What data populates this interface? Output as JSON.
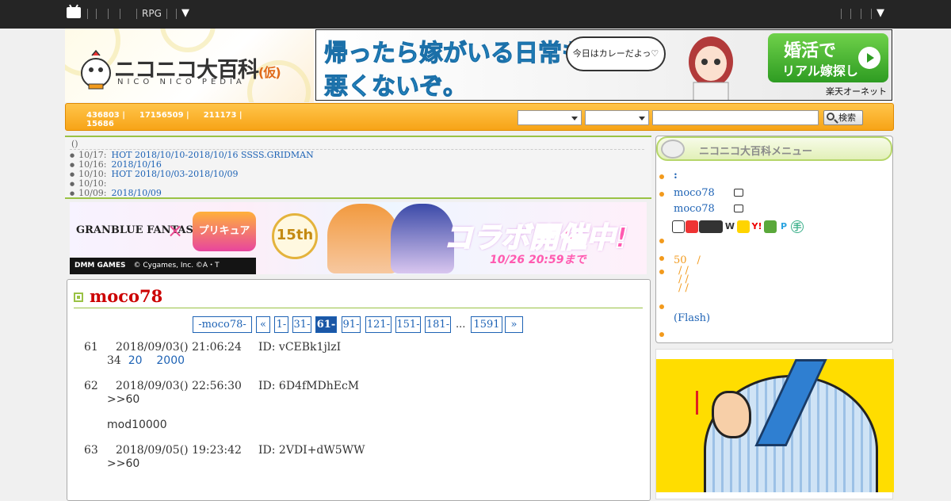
{
  "topbar": {
    "rpg_label": "RPG",
    "dropdown_caret": "▼",
    "right_caret": "▼"
  },
  "header": {
    "logo_text": "ニコニコ大百科",
    "logo_kari": "(仮)",
    "logo_sub": "NICO NICO PEDIA",
    "banner": {
      "line1": "帰ったら嫁がいる日常も",
      "line2": "悪くないぞ。",
      "bubble": "今日はカレーだよっ♡",
      "cta_line1": "婚活で",
      "cta_line2": "リアル嫁探し",
      "sponsor": "楽天オーネット"
    }
  },
  "stats": {
    "s1": "436803 |",
    "s2": "17156509 |",
    "s3": "211173 |",
    "s4": "15686"
  },
  "search": {
    "button_label": "検索",
    "placeholder": ""
  },
  "news": {
    "heading": "()",
    "items": [
      {
        "date": "10/17:",
        "text": "HOT 2018/10/10-2018/10/16 SSSS.GRIDMAN"
      },
      {
        "date": "10/16:",
        "text": "2018/10/16"
      },
      {
        "date": "10/10:",
        "text": "HOT 2018/10/03-2018/10/09"
      },
      {
        "date": "10/10:",
        "text": ""
      },
      {
        "date": "10/09:",
        "text": "2018/10/09"
      }
    ]
  },
  "collab_banner": {
    "gbf": "GRANBLUE FANTASY",
    "cross": "×",
    "precure": "プリキュア",
    "anniv": "15th",
    "catch": "コラボ開催中!",
    "until": "10/26 20:59まで",
    "footer_brand": "DMM GAMES",
    "footer_copy": "© Cygames, Inc.  ©A・T"
  },
  "article": {
    "title": "moco78",
    "pager": [
      {
        "label": "-moco78-"
      },
      {
        "label": "«"
      },
      {
        "label": "1-"
      },
      {
        "label": "31-"
      },
      {
        "label": "61-",
        "active": true
      },
      {
        "label": "91-"
      },
      {
        "label": "121-"
      },
      {
        "label": "151-"
      },
      {
        "label": "181-"
      },
      {
        "label": "..."
      },
      {
        "label": "1591"
      },
      {
        "label": "»"
      }
    ],
    "posts": [
      {
        "num": "61",
        "datetime": "2018/09/03() 21:06:24",
        "id": "ID: vCEBk1jlzI",
        "body_prefix": "34",
        "links": [
          "20",
          "2000"
        ]
      },
      {
        "num": "62",
        "datetime": "2018/09/03() 22:56:30",
        "id": "ID: 6D4fMDhEcM",
        "reply": ">>60",
        "extra": "mod10000"
      },
      {
        "num": "63",
        "datetime": "2018/09/05() 19:23:42",
        "id": "ID: 2VDI+dW5WW",
        "reply": ">>60"
      }
    ]
  },
  "sidebar": {
    "menu_title": "ニコニコ大百科メニュー",
    "items": [
      {
        "text": ":"
      },
      {
        "text": "moco78"
      },
      {
        "text": "moco78"
      },
      {
        "text": ""
      },
      {
        "text": "50　/"
      },
      {
        "text": "/ /"
      },
      {
        "text": "/ /"
      },
      {
        "text": "/ /"
      },
      {
        "text": ""
      },
      {
        "text": "(Flash)"
      },
      {
        "text": ""
      }
    ],
    "icon_row": [
      "W",
      "Y!",
      "P",
      "手"
    ]
  }
}
